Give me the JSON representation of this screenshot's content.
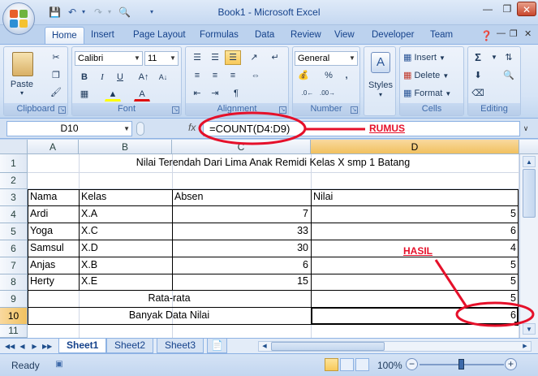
{
  "window": {
    "title": "Book1 - Microsoft Excel"
  },
  "tabs": [
    "Home",
    "Insert",
    "Page Layout",
    "Formulas",
    "Data",
    "Review",
    "View",
    "Developer",
    "Team"
  ],
  "ribbon": {
    "paste_label": "Paste",
    "font_name": "Calibri",
    "font_size": "11",
    "number_format": "General",
    "styles_label": "Styles",
    "insert_label": "Insert",
    "delete_label": "Delete",
    "format_label": "Format",
    "groups": {
      "clipboard": "Clipboard",
      "font": "Font",
      "alignment": "Alignment",
      "number": "Number",
      "cells": "Cells",
      "editing": "Editing"
    }
  },
  "formula_bar": {
    "cell_ref": "D10",
    "fx": "fx",
    "formula": "=COUNT(D4:D9)"
  },
  "columns": [
    "A",
    "B",
    "C",
    "D"
  ],
  "rows": [
    "1",
    "2",
    "3",
    "4",
    "5",
    "6",
    "7",
    "8",
    "9",
    "10",
    "11"
  ],
  "sheet": {
    "title": "Nilai Terendah Dari Lima Anak Remidi Kelas X smp 1 Batang",
    "headers": {
      "nama": "Nama",
      "kelas": "Kelas",
      "absen": "Absen",
      "nilai": "Nilai"
    },
    "records": [
      {
        "nama": "Ardi",
        "kelas": "X.A",
        "absen": "7",
        "nilai": "5"
      },
      {
        "nama": "Yoga",
        "kelas": "X.C",
        "absen": "33",
        "nilai": "6"
      },
      {
        "nama": "Samsul",
        "kelas": "X.D",
        "absen": "30",
        "nilai": "4"
      },
      {
        "nama": "Anjas",
        "kelas": "X.B",
        "absen": "6",
        "nilai": "5"
      },
      {
        "nama": "Herty",
        "kelas": "X.E",
        "absen": "15",
        "nilai": "5"
      }
    ],
    "rata_label": "Rata-rata",
    "rata_value": "5",
    "banyak_label": "Banyak Data Nilai",
    "banyak_value": "6"
  },
  "sheet_tabs": [
    "Sheet1",
    "Sheet2",
    "Sheet3"
  ],
  "annotations": {
    "rumus": "RUMUS",
    "hasil": "HASIL",
    "color": "#e5102a"
  },
  "status": {
    "ready": "Ready",
    "zoom": "100%"
  }
}
